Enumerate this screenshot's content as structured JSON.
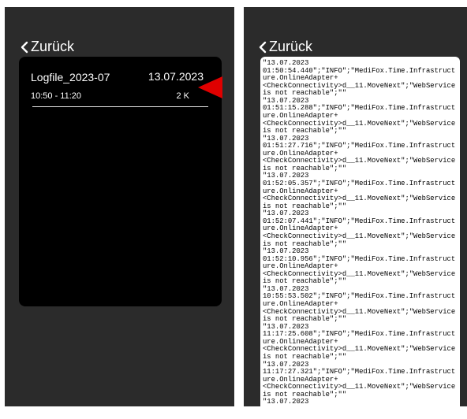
{
  "left": {
    "back_label": "Zurück",
    "entry": {
      "name": "Logfile_2023-07",
      "date": "13.07.2023",
      "time_range": "10:50 - 11:20",
      "size": "2 K"
    },
    "indicator_color": "#e00000"
  },
  "right": {
    "back_label": "Zurück",
    "log_lines": [
      "\"13.07.2023",
      "01:50:54.440\";\"INFO\";\"MediFox.Time.Infrastruct",
      "ure.OnlineAdapter+",
      "<CheckConnectivity>d__11.MoveNext\";\"WebService",
      "is not reachable\";\"\"",
      "\"13.07.2023",
      "01:51:15.288\";\"INFO\";\"MediFox.Time.Infrastruct",
      "ure.OnlineAdapter+",
      "<CheckConnectivity>d__11.MoveNext\";\"WebService",
      "is not reachable\";\"\"",
      "\"13.07.2023",
      "01:51:27.716\";\"INFO\";\"MediFox.Time.Infrastruct",
      "ure.OnlineAdapter+",
      "<CheckConnectivity>d__11.MoveNext\";\"WebService",
      "is not reachable\";\"\"",
      "\"13.07.2023",
      "01:52:05.357\";\"INFO\";\"MediFox.Time.Infrastruct",
      "ure.OnlineAdapter+",
      "<CheckConnectivity>d__11.MoveNext\";\"WebService",
      "is not reachable\";\"\"",
      "\"13.07.2023",
      "01:52:07.441\";\"INFO\";\"MediFox.Time.Infrastruct",
      "ure.OnlineAdapter+",
      "<CheckConnectivity>d__11.MoveNext\";\"WebService",
      "is not reachable\";\"\"",
      "\"13.07.2023",
      "01:52:10.956\";\"INFO\";\"MediFox.Time.Infrastruct",
      "ure.OnlineAdapter+",
      "<CheckConnectivity>d__11.MoveNext\";\"WebService",
      "is not reachable\";\"\"",
      "\"13.07.2023",
      "10:55:53.502\";\"INFO\";\"MediFox.Time.Infrastruct",
      "ure.OnlineAdapter+",
      "<CheckConnectivity>d__11.MoveNext\";\"WebService",
      "is not reachable\";\"\"",
      "\"13.07.2023",
      "11:17:25.608\";\"INFO\";\"MediFox.Time.Infrastruct",
      "ure.OnlineAdapter+",
      "<CheckConnectivity>d__11.MoveNext\";\"WebService",
      "is not reachable\";\"\"",
      "\"13.07.2023",
      "11:17:27.321\";\"INFO\";\"MediFox.Time.Infrastruct",
      "ure.OnlineAdapter+",
      "<CheckConnectivity>d__11.MoveNext\";\"WebService",
      "is not reachable\";\"\"",
      "\"13.07.2023"
    ]
  }
}
